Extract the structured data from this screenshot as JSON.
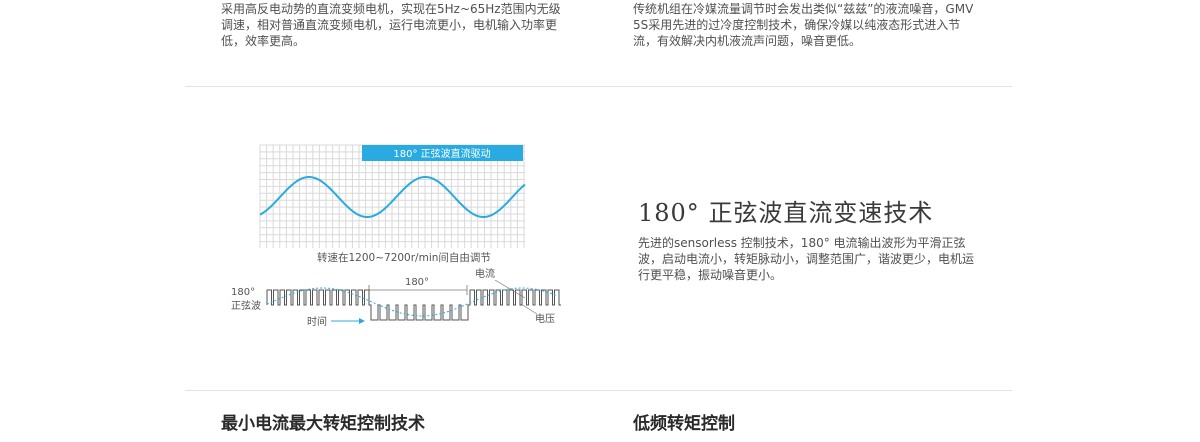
{
  "top": {
    "left_text": "采用高反电动势的直流变频电机，实现在5Hz~65Hz范围内无级调速，相对普通直流变频电机，运行电流更小，电机输入功率更低，效率更高。",
    "right_text": "传统机组在冷媒流量调节时会发出类似“兹兹”的液流噪音，GMV 5S采用先进的过冷度控制技术，确保冷媒以纯液态形式进入节流，有效解决内机液流声问题，噪音更低。"
  },
  "feature": {
    "title": "180° 正弦波直流变速技术",
    "description": "先进的sensorless 控制技术，180° 电流输出波形为平滑正弦波，启动电流小，转矩脉动小，调整范围广，谐波更少，电机运行更平稳，振动噪音更小。"
  },
  "diagram": {
    "banner": "180° 正弦波直流驱动",
    "caption": "转速在1200~7200r/min间自由调节",
    "angle_label": "180°",
    "left_label_line1": "180°",
    "left_label_line2": "正弦波",
    "time_label": "时间",
    "current_label": "电流",
    "voltage_label": "电压",
    "accent_color": "#29abe2"
  },
  "bottom": {
    "left_title": "最小电流最大转矩控制技术",
    "right_title": "低频转矩控制"
  }
}
